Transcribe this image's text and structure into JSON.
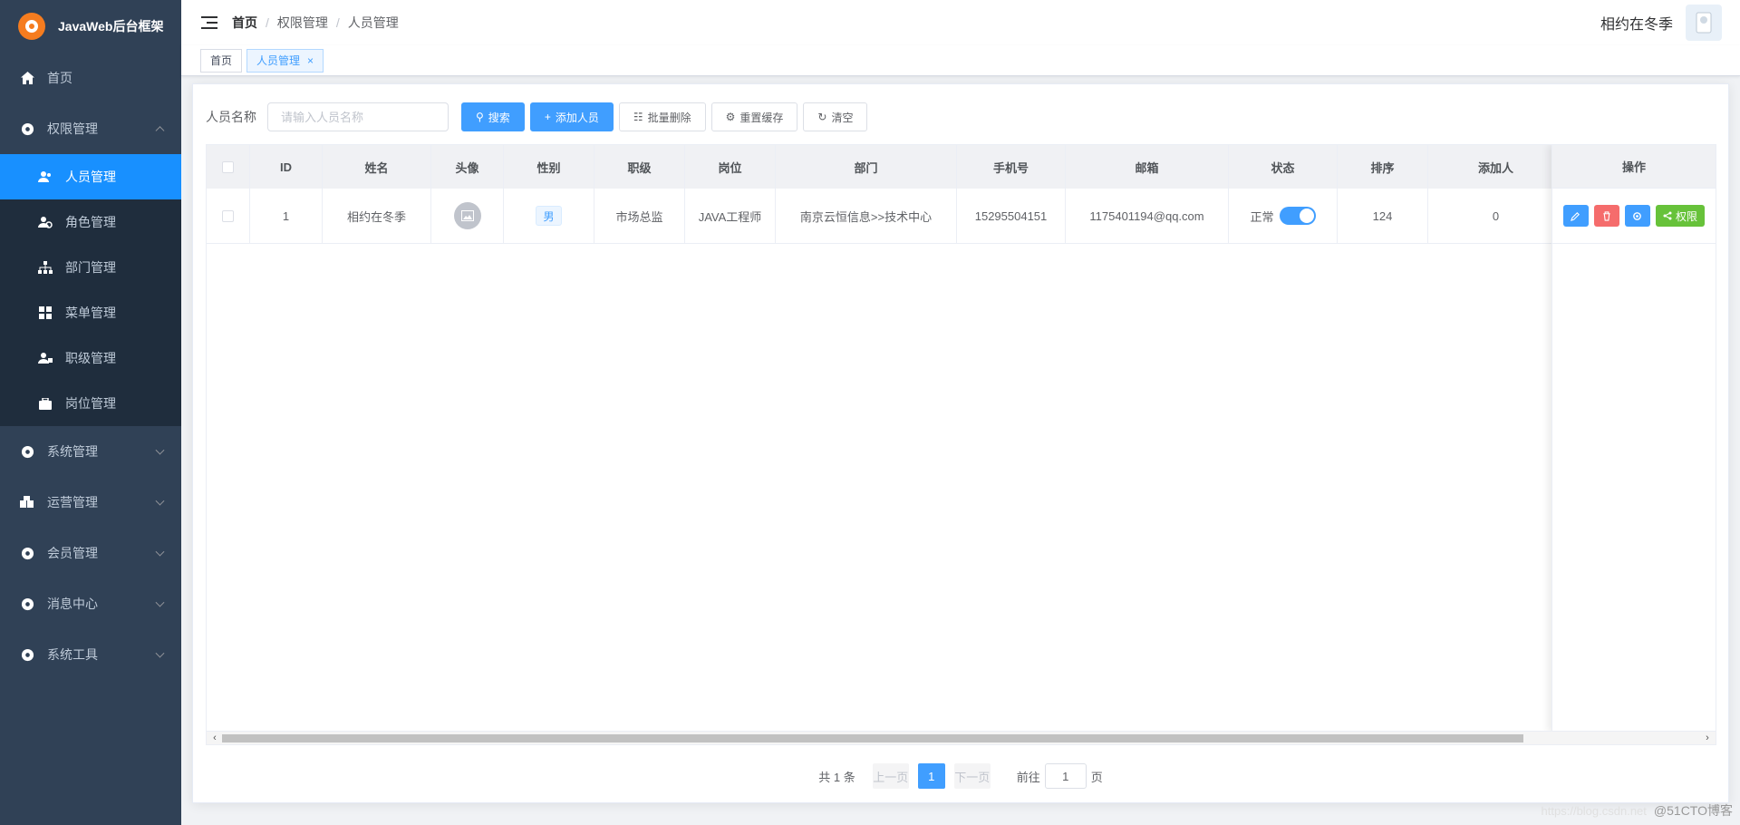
{
  "app": {
    "title": "JavaWeb后台框架"
  },
  "sidebar": {
    "items": [
      {
        "label": "首页",
        "icon": "home-icon"
      },
      {
        "label": "权限管理",
        "icon": "settings-icon",
        "expanded": true,
        "children": [
          {
            "label": "人员管理",
            "icon": "users-icon",
            "active": true
          },
          {
            "label": "角色管理",
            "icon": "user-role-icon"
          },
          {
            "label": "部门管理",
            "icon": "sitemap-icon"
          },
          {
            "label": "菜单管理",
            "icon": "grid-icon"
          },
          {
            "label": "职级管理",
            "icon": "user-level-icon"
          },
          {
            "label": "岗位管理",
            "icon": "briefcase-icon"
          }
        ]
      },
      {
        "label": "系统管理",
        "icon": "settings-icon"
      },
      {
        "label": "运营管理",
        "icon": "cubes-icon"
      },
      {
        "label": "会员管理",
        "icon": "settings-icon"
      },
      {
        "label": "消息中心",
        "icon": "settings-icon"
      },
      {
        "label": "系统工具",
        "icon": "settings-icon"
      }
    ]
  },
  "header": {
    "breadcrumb": [
      "首页",
      "权限管理",
      "人员管理"
    ],
    "user_name": "相约在冬季"
  },
  "tags": [
    {
      "label": "首页",
      "active": false
    },
    {
      "label": "人员管理",
      "active": true,
      "close": "×"
    }
  ],
  "search": {
    "label": "人员名称",
    "placeholder": "请输入人员名称",
    "buttons": {
      "search": "搜索",
      "add": "添加人员",
      "batch_delete": "批量删除",
      "reset_cache": "重置缓存",
      "clear": "清空"
    }
  },
  "table": {
    "columns": [
      "ID",
      "姓名",
      "头像",
      "性别",
      "职级",
      "岗位",
      "部门",
      "手机号",
      "邮箱",
      "状态",
      "排序",
      "添加人",
      "操作"
    ],
    "rows": [
      {
        "id": "1",
        "name": "相约在冬季",
        "gender": "男",
        "level": "市场总监",
        "position": "JAVA工程师",
        "dept": "南京云恒信息>>技术中心",
        "phone": "15295504151",
        "email": "1175401194@qq.com",
        "status": "正常",
        "status_on": true,
        "sort": "124",
        "creator": "0",
        "actions": {
          "permission": "权限"
        }
      }
    ]
  },
  "pagination": {
    "total": "共 1 条",
    "prev": "上一页",
    "current": "1",
    "next": "下一页",
    "goto_label": "前往",
    "goto_value": "1",
    "page_suffix": "页"
  },
  "watermark": {
    "faint": "https://blog.csdn.net",
    "text": "@51CTO博客"
  },
  "colors": {
    "sidebar_bg": "#304156",
    "active": "#1890ff",
    "primary": "#409eff",
    "danger": "#f56c6c",
    "success": "#67c23a"
  }
}
